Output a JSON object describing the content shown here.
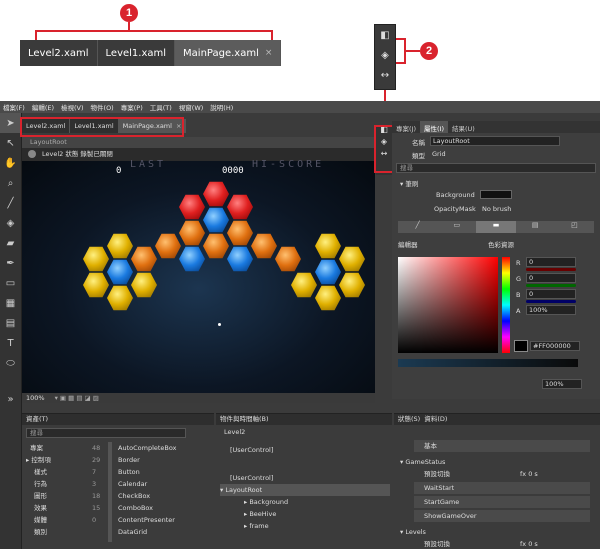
{
  "callout": {
    "tabs": [
      "Level2.xaml",
      "Level1.xaml",
      "MainPage.xaml"
    ],
    "close": "×",
    "badge1": "1",
    "badge2": "2"
  },
  "menu": [
    "檔案(F)",
    "編輯(E)",
    "檢視(V)",
    "物件(O)",
    "專案(P)",
    "工具(T)",
    "視窗(W)",
    "說明(H)"
  ],
  "doc_tabs": [
    "Level2.xaml",
    "Level1.xaml",
    "MainPage.xaml"
  ],
  "doc_close": "×",
  "designer": {
    "breadcrumb": "LayoutRoot",
    "status": "Level2 狀態 錄製已關閉",
    "score_left": "0",
    "score_right": "0000",
    "ghost_left": "LAST",
    "ghost_right": "HI-SCORE",
    "zoom": "100%"
  },
  "right_tabs": [
    "專案(J)",
    "屬性(I)",
    "結果(U)"
  ],
  "props": {
    "name_label": "名稱",
    "name_value": "LayoutRoot",
    "type_label": "類型",
    "type_value": "Grid",
    "search_placeholder": "搜尋",
    "brush_section": "筆刷",
    "background_label": "Background",
    "opacity_label": "OpacityMask",
    "opacity_value": "No brush",
    "editor_label": "編輯器",
    "resource_label": "色彩資源",
    "r_label": "R",
    "r_value": "0",
    "g_label": "G",
    "g_value": "0",
    "b_label": "B",
    "b_value": "0",
    "a_label": "A",
    "a_value": "100%",
    "hex_value": "#FF000000",
    "grad_value": "100%"
  },
  "assets": {
    "title": "資產(T)",
    "search": "搜尋",
    "categories": [
      {
        "label": "專案",
        "count": "48"
      },
      {
        "label": "控制項",
        "count": "29"
      },
      {
        "label": "樣式",
        "count": "7"
      },
      {
        "label": "行為",
        "count": "3"
      },
      {
        "label": "圖形",
        "count": "18"
      },
      {
        "label": "效果",
        "count": "15"
      },
      {
        "label": "媒體",
        "count": "0"
      },
      {
        "label": "類別",
        "count": ""
      }
    ],
    "items": [
      "AutoCompleteBox",
      "Border",
      "Button",
      "Calendar",
      "CheckBox",
      "ComboBox",
      "ContentPresenter",
      "DataGrid"
    ]
  },
  "objects": {
    "title": "物件與時間軸(B)",
    "level": "Level2",
    "items": [
      "[UserControl]",
      "[UserControl]",
      "LayoutRoot",
      "Background",
      "BeeHive",
      "frame"
    ]
  },
  "states": {
    "tabs": [
      "狀態(S)",
      "資料(D)"
    ],
    "base": "基本",
    "group1": "GameStatus",
    "default_transition": "預設切換",
    "time": "0 s",
    "fx": "fx",
    "states1": [
      "WaitStart",
      "StartGame",
      "ShowGameOver"
    ],
    "group2": "Levels",
    "default_transition2": "預設切換",
    "time2": "0 s"
  }
}
